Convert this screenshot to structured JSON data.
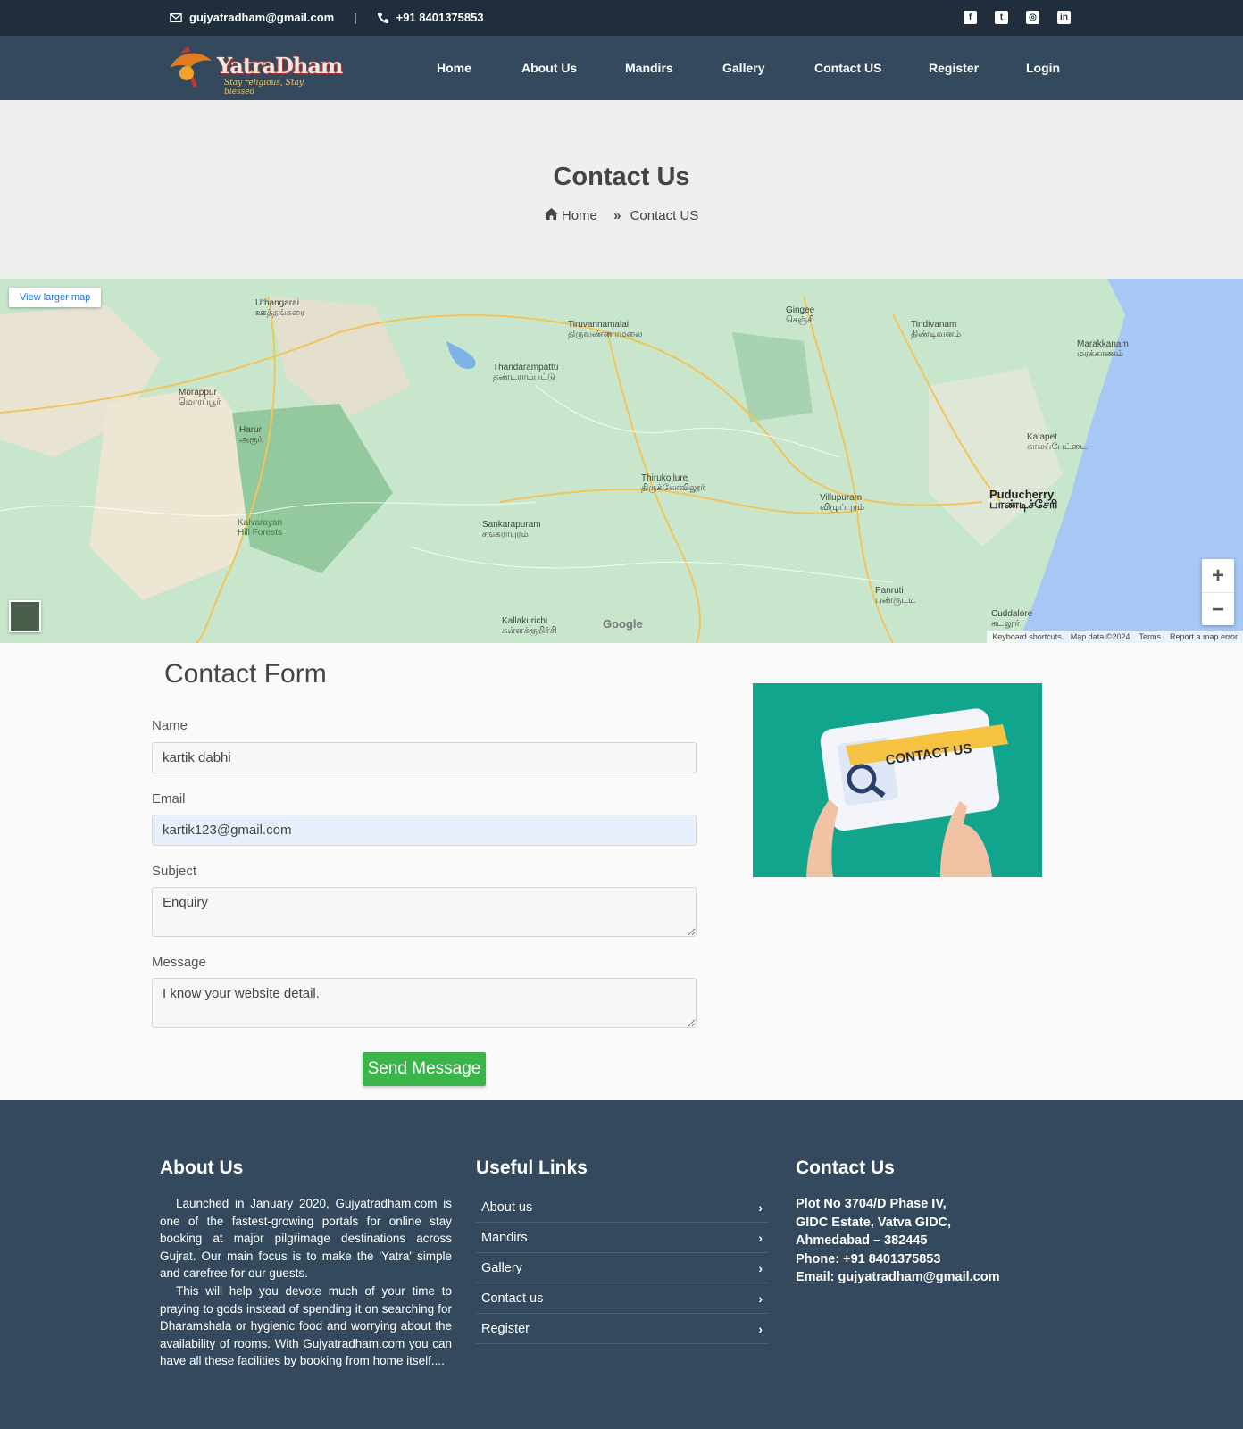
{
  "topbar": {
    "email": "gujyatradham@gmail.com",
    "separator": "|",
    "phone": "+91 8401375853",
    "social_icons": [
      "facebook-icon",
      "twitter-icon",
      "instagram-icon",
      "linkedin-icon"
    ]
  },
  "logo": {
    "text": "YatraDham",
    "tagline": "Stay religious, Stay blessed"
  },
  "nav": {
    "items": [
      "Home",
      "About Us",
      "Mandirs",
      "Gallery",
      "Contact US",
      "Register",
      "Login"
    ]
  },
  "page_header": {
    "title": "Contact Us",
    "breadcrumb_home": "Home",
    "breadcrumb_current": "Contact US"
  },
  "map": {
    "larger_map_link": "View larger map",
    "zoom_in": "+",
    "zoom_out": "−",
    "google": "Google",
    "attribution": [
      "Keyboard shortcuts",
      "Map data ©2024",
      "Terms",
      "Report a map error"
    ],
    "places": [
      "Tiruvannamalai",
      "திருவண்ணாமலை",
      "Puducherry",
      "பாண்டிச்சேரி",
      "Villupuram",
      "விழுப்புரம்",
      "Gingee",
      "செஞ்சி",
      "Tindivanam",
      "திண்டிவனம்",
      "Kallakurichi",
      "கள்ளக்குறிச்சி",
      "Kalvarayan Hill Forests",
      "Cuddalore",
      "கடலூர்",
      "Uthangarai",
      "ஊத்தங்கரை",
      "Harur",
      "அரூர்",
      "Thandarampattu",
      "தண்டராம்பட்டு",
      "Thirukoilure",
      "திருக்கோவிலூர்",
      "Marakkanam",
      "மரக்காணம்",
      "Panruti",
      "பண்ருட்டி",
      "Sankarapuram",
      "சங்கராபுரம்",
      "Morappur",
      "மொரப்பூர்",
      "Kalapet",
      "காலப்பேட்டை"
    ]
  },
  "contact_form": {
    "title": "Contact Form",
    "name_label": "Name",
    "name_value": "kartik dabhi",
    "email_label": "Email",
    "email_value": "kartik123@gmail.com",
    "subject_label": "Subject",
    "subject_value": "Enquiry",
    "message_label": "Message",
    "message_value": "I know your website detail.",
    "send_label": "Send Message"
  },
  "contact_image": {
    "banner_text": "CONTACT US"
  },
  "footer": {
    "about_title": "About Us",
    "about_p1": "Launched in January 2020, Gujyatradham.com is one of the fastest-growing portals for online stay booking at major pilgrimage destinations across Gujrat. Our main focus is to make the 'Yatra' simple and carefree for our guests.",
    "about_p2": "This will help you devote much of your time to praying to gods instead of spending it on searching for Dharamshala or hygienic food and worrying about the availability of rooms. With Gujyatradham.com you can have all these facilities by booking from home itself....",
    "links_title": "Useful Links",
    "links": [
      "About us",
      "Mandirs",
      "Gallery",
      "Contact us",
      "Register"
    ],
    "contact_title": "Contact Us",
    "address_lines": [
      "Plot No 3704/D Phase IV,",
      "GIDC Estate, Vatva GIDC,",
      "Ahmedabad – 382445",
      "Phone: +91 8401375853",
      "Email: gujyatradham@gmail.com"
    ]
  }
}
